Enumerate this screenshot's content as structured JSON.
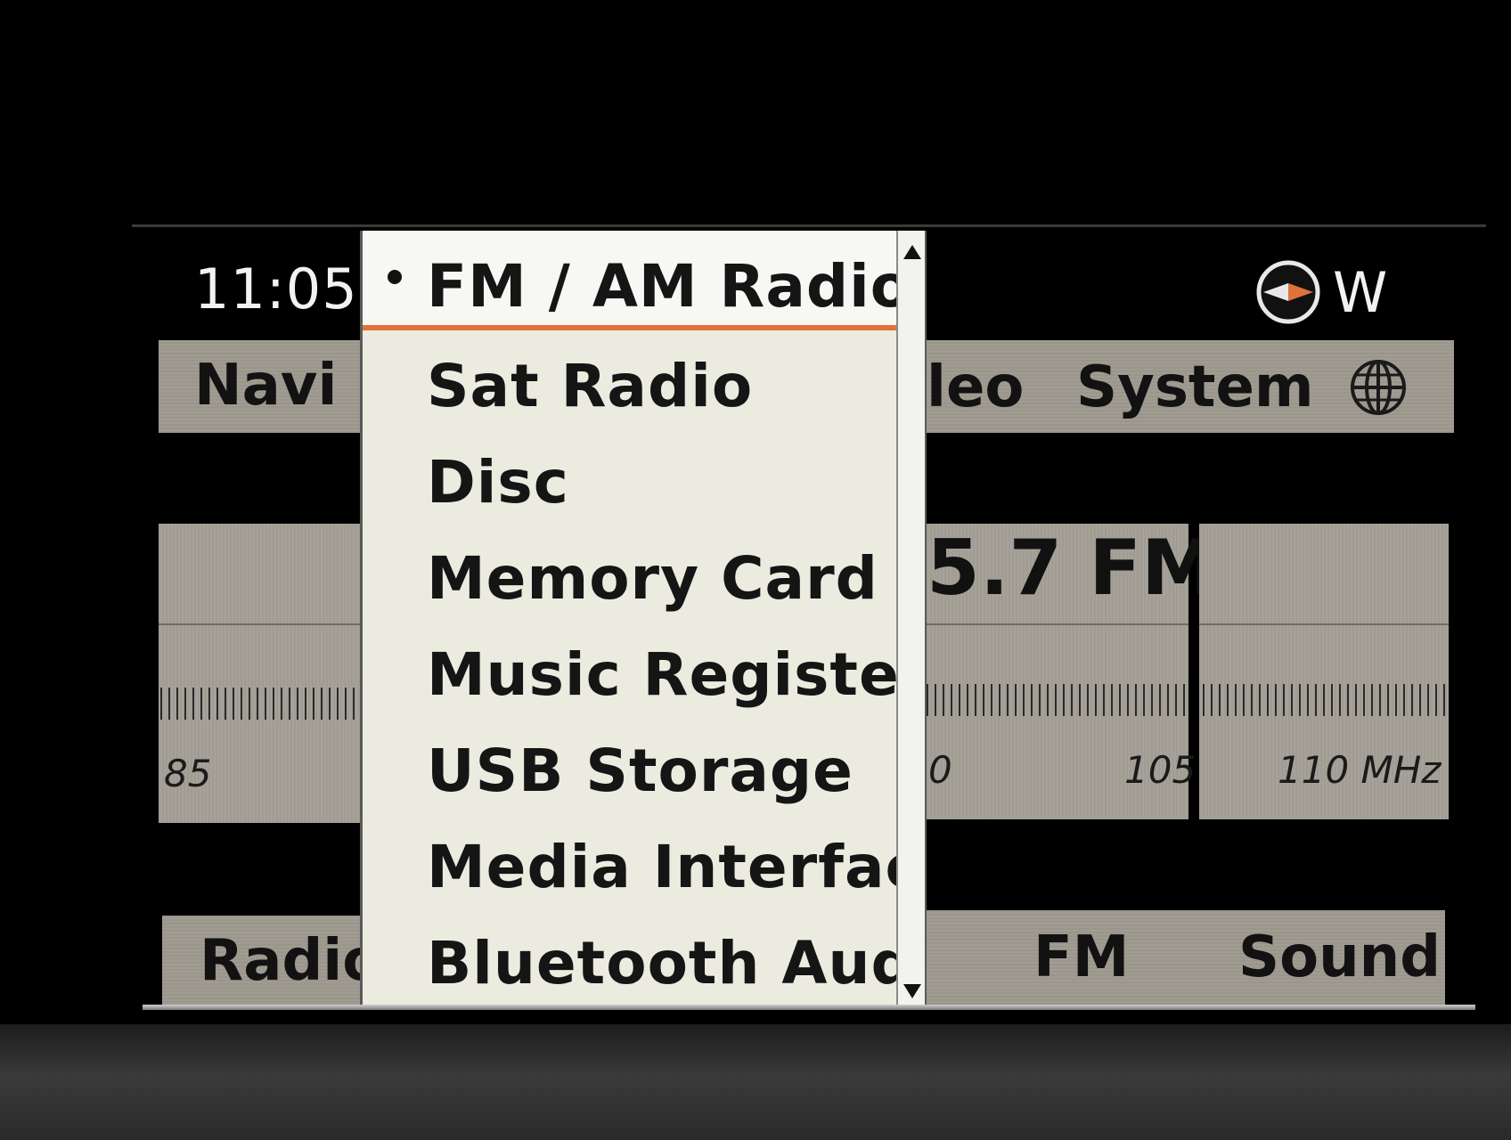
{
  "status": {
    "clock": "11:05",
    "heading": "W",
    "compass_icon": "compass-icon"
  },
  "top_menu": {
    "navi": "Navi",
    "video_partial": "leo",
    "system": "System",
    "globe_icon": "globe-icon"
  },
  "tuner": {
    "frequency_partial": "5.7 FM",
    "scale_left": "85",
    "scale_mid_partial": "0",
    "scale_105": "105",
    "scale_right": "110 MHz"
  },
  "bottom_menu": {
    "radio": "Radio",
    "fm": "FM",
    "sound": "Sound"
  },
  "source_menu": {
    "selected": "FM / AM Radio",
    "items": [
      "Sat Radio",
      "Disc",
      "Memory Card",
      "Music Register",
      "USB Storage",
      "Media Interface",
      "Bluetooth Audio"
    ]
  },
  "colors": {
    "accent": "#e0733a",
    "panel": "#a6a298"
  }
}
